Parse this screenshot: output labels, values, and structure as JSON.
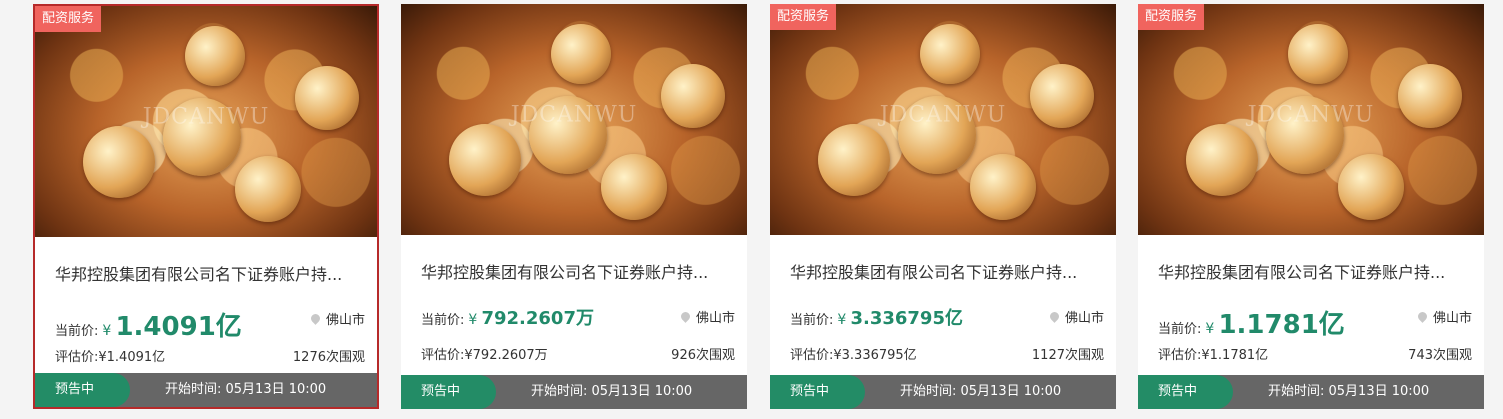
{
  "watermark": "JDCANWU",
  "cards": [
    {
      "tag": "配资服务",
      "title": "华邦控股集团有限公司名下证券账户持...",
      "price_label": "当前价:",
      "currency": "¥",
      "price": "1.4091亿",
      "location": "佛山市",
      "appraisal": "评估价:¥1.4091亿",
      "views": "1276次围观",
      "status": "预告中",
      "start_time": "开始时间: 05月13日 10:00",
      "selected": true
    },
    {
      "tag": "",
      "title": "华邦控股集团有限公司名下证券账户持...",
      "price_label": "当前价:",
      "currency": "¥",
      "price": "792.2607万",
      "location": "佛山市",
      "appraisal": "评估价:¥792.2607万",
      "views": "926次围观",
      "status": "预告中",
      "start_time": "开始时间: 05月13日 10:00",
      "selected": false
    },
    {
      "tag": "配资服务",
      "title": "华邦控股集团有限公司名下证券账户持...",
      "price_label": "当前价:",
      "currency": "¥",
      "price": "3.336795亿",
      "location": "佛山市",
      "appraisal": "评估价:¥3.336795亿",
      "views": "1127次围观",
      "status": "预告中",
      "start_time": "开始时间: 05月13日 10:00",
      "selected": false
    },
    {
      "tag": "配资服务",
      "title": "华邦控股集团有限公司名下证券账户持...",
      "price_label": "当前价:",
      "currency": "¥",
      "price": "1.1781亿",
      "location": "佛山市",
      "appraisal": "评估价:¥1.1781亿",
      "views": "743次围观",
      "status": "预告中",
      "start_time": "开始时间: 05月13日 10:00",
      "selected": false
    }
  ],
  "colors": {
    "accent": "#218a6a",
    "tag": "#f0645e",
    "selected_border": "#b62a2a",
    "footer": "#666666"
  }
}
